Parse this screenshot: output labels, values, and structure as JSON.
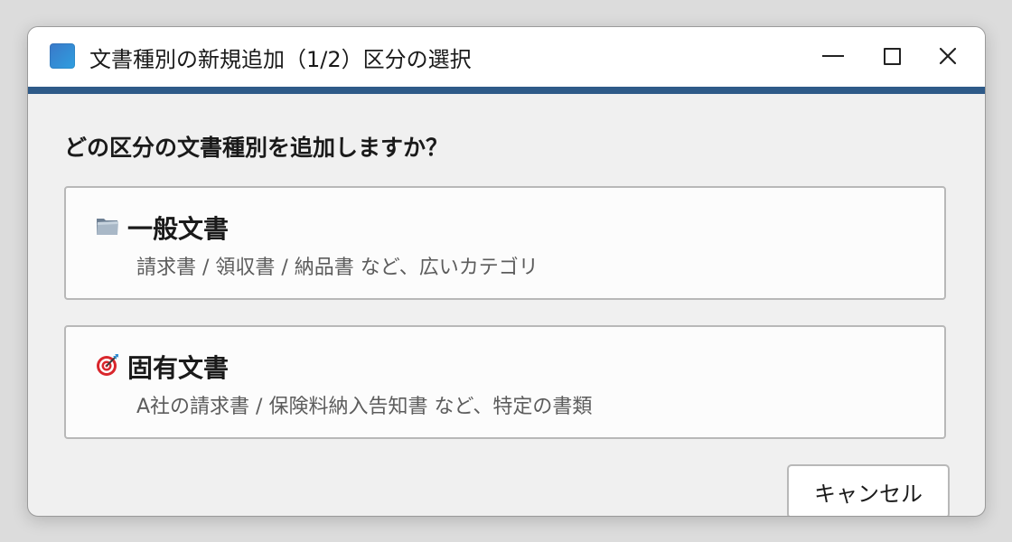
{
  "window": {
    "title": "文書種別の新規追加（1/2）区分の選択"
  },
  "icons": {
    "app": "app-icon",
    "minimize": "minimize-icon",
    "maximize": "maximize-icon",
    "close": "close-icon",
    "general": "folder-icon",
    "specific": "target-icon"
  },
  "colors": {
    "accent": "#2e5a88",
    "app_icon": "#3a86d0"
  },
  "dialog": {
    "question": "どの区分の文書種別を追加しますか？",
    "options": [
      {
        "title": "一般文書",
        "description": "請求書 / 領収書 / 納品書 など、広いカテゴリ"
      },
      {
        "title": "固有文書",
        "description": "A社の請求書 / 保険料納入告知書 など、特定の書類"
      }
    ],
    "cancel_label": "キャンセル"
  }
}
